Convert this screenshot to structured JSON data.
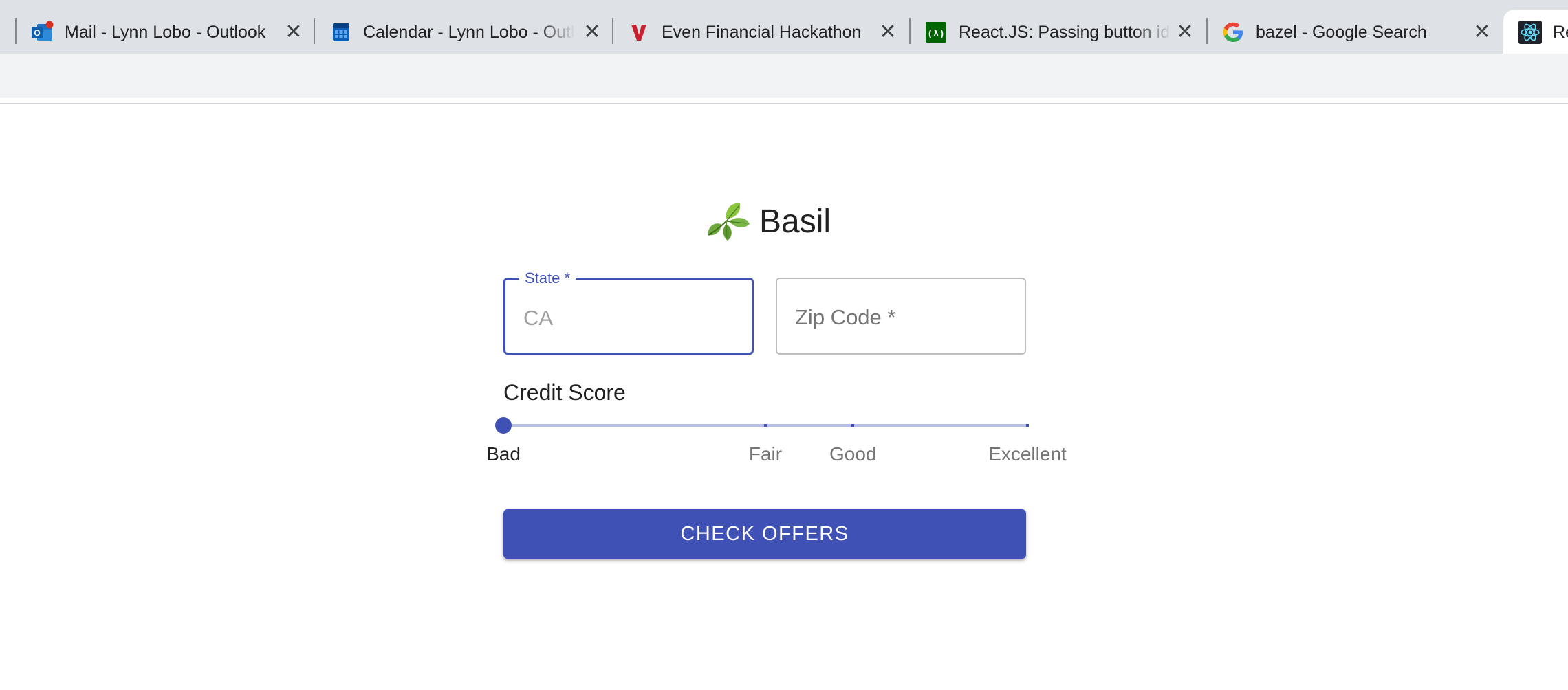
{
  "browser": {
    "tabs": [
      {
        "title": "Mail - Lynn Lobo - Outlook",
        "icon": "outlook-mail-icon",
        "active": false
      },
      {
        "title": "Calendar - Lynn Lobo - Outlook",
        "icon": "outlook-calendar-icon",
        "active": false
      },
      {
        "title": "Even Financial Hackathon",
        "icon": "even-financial-icon",
        "active": false
      },
      {
        "title": "React.JS: Passing button id",
        "icon": "freecodecamp-icon",
        "active": false
      },
      {
        "title": "bazel - Google Search",
        "icon": "google-icon",
        "active": false
      },
      {
        "title": "React App",
        "icon": "react-icon",
        "active": true
      }
    ],
    "close_glyph": "✕"
  },
  "app": {
    "name": "Basil",
    "logo_icon": "basil-leaf-icon"
  },
  "form": {
    "state": {
      "label": "State *",
      "value": "CA",
      "focused": true
    },
    "zip": {
      "label": "Zip Code *",
      "value": ""
    },
    "credit_score": {
      "label": "Credit Score",
      "options": [
        "Bad",
        "Fair",
        "Good",
        "Excellent"
      ],
      "selected": "Bad",
      "selected_fraction": 0.0
    },
    "submit_label": "CHECK OFFERS"
  },
  "colors": {
    "primary": "#3f51b5",
    "rail": "#b8bfe6",
    "tabstrip": "#dee1e6",
    "toolbar": "#f1f3f4"
  }
}
